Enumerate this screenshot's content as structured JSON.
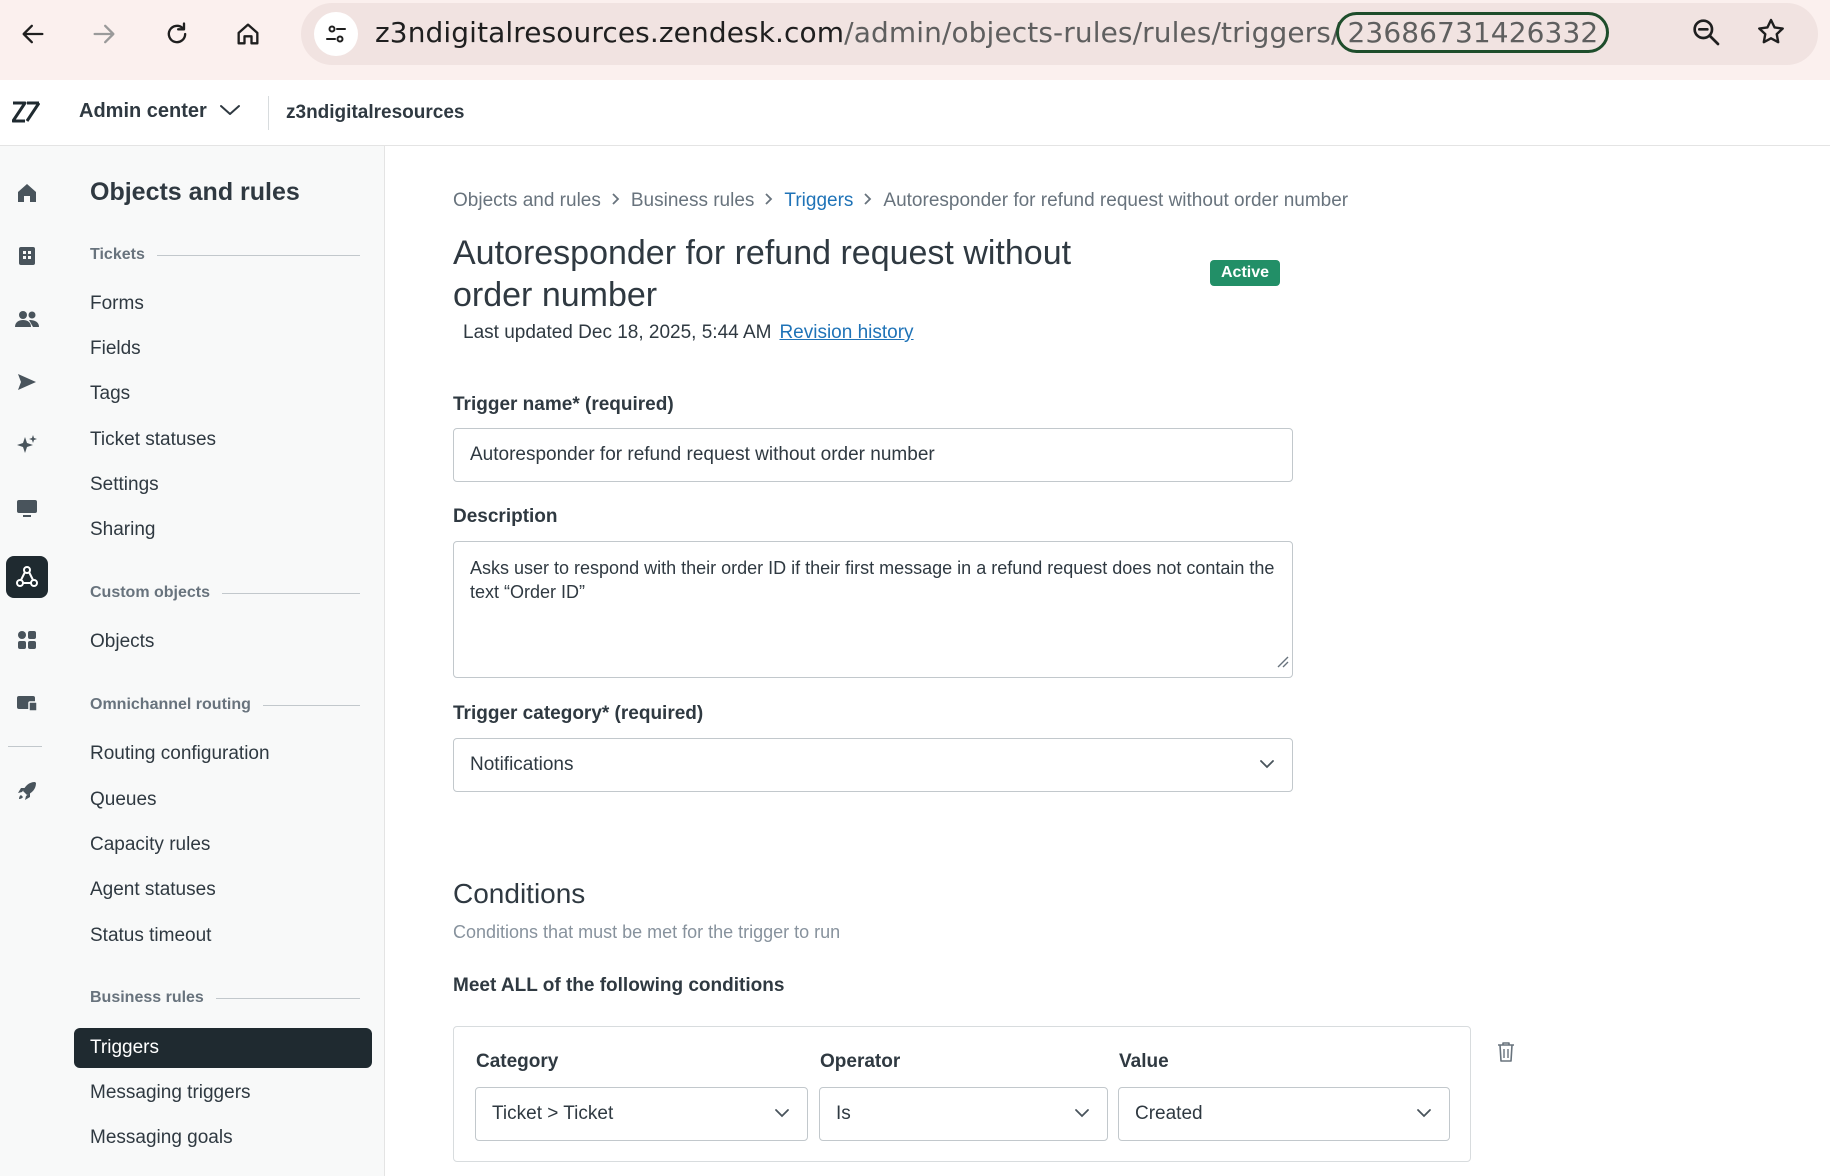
{
  "browser": {
    "url_host": "z3ndigitalresources.zendesk.com",
    "url_path": "/admin/objects-rules/rules/triggers/",
    "url_id": "23686731426332"
  },
  "header": {
    "product": "Admin center",
    "account": "z3ndigitalresources"
  },
  "sidebar": {
    "title": "Objects and rules",
    "sections": {
      "tickets": "Tickets",
      "custom_objects": "Custom objects",
      "omnichannel": "Omnichannel routing",
      "business_rules": "Business rules"
    },
    "items": {
      "forms": "Forms",
      "fields": "Fields",
      "tags": "Tags",
      "ticket_statuses": "Ticket statuses",
      "settings": "Settings",
      "sharing": "Sharing",
      "objects": "Objects",
      "routing_configuration": "Routing configuration",
      "queues": "Queues",
      "capacity_rules": "Capacity rules",
      "agent_statuses": "Agent statuses",
      "status_timeout": "Status timeout",
      "triggers": "Triggers",
      "messaging_triggers": "Messaging triggers",
      "messaging_goals": "Messaging goals"
    }
  },
  "breadcrumb": {
    "objects_and_rules": "Objects and rules",
    "business_rules": "Business rules",
    "triggers": "Triggers",
    "current": "Autoresponder for refund request without order number"
  },
  "page": {
    "title": "Autoresponder for refund request without order number",
    "status": "Active",
    "last_updated": "Last updated Dec 18, 2025, 5:44 AM",
    "revision_history": "Revision history"
  },
  "form": {
    "name_label": "Trigger name* (required)",
    "name_value": "Autoresponder for refund request without order number",
    "description_label": "Description",
    "description_value": "Asks user to respond with their order ID if their first message in a refund request does not contain the text “Order ID”",
    "category_label": "Trigger category* (required)",
    "category_value": "Notifications"
  },
  "conditions": {
    "title": "Conditions",
    "subtitle": "Conditions that must be met for the trigger to run",
    "meet_all": "Meet ALL of the following conditions",
    "category_label": "Category",
    "operator_label": "Operator",
    "value_label": "Value",
    "row": {
      "category": "Ticket > Ticket",
      "operator": "Is",
      "value": "Created"
    }
  }
}
